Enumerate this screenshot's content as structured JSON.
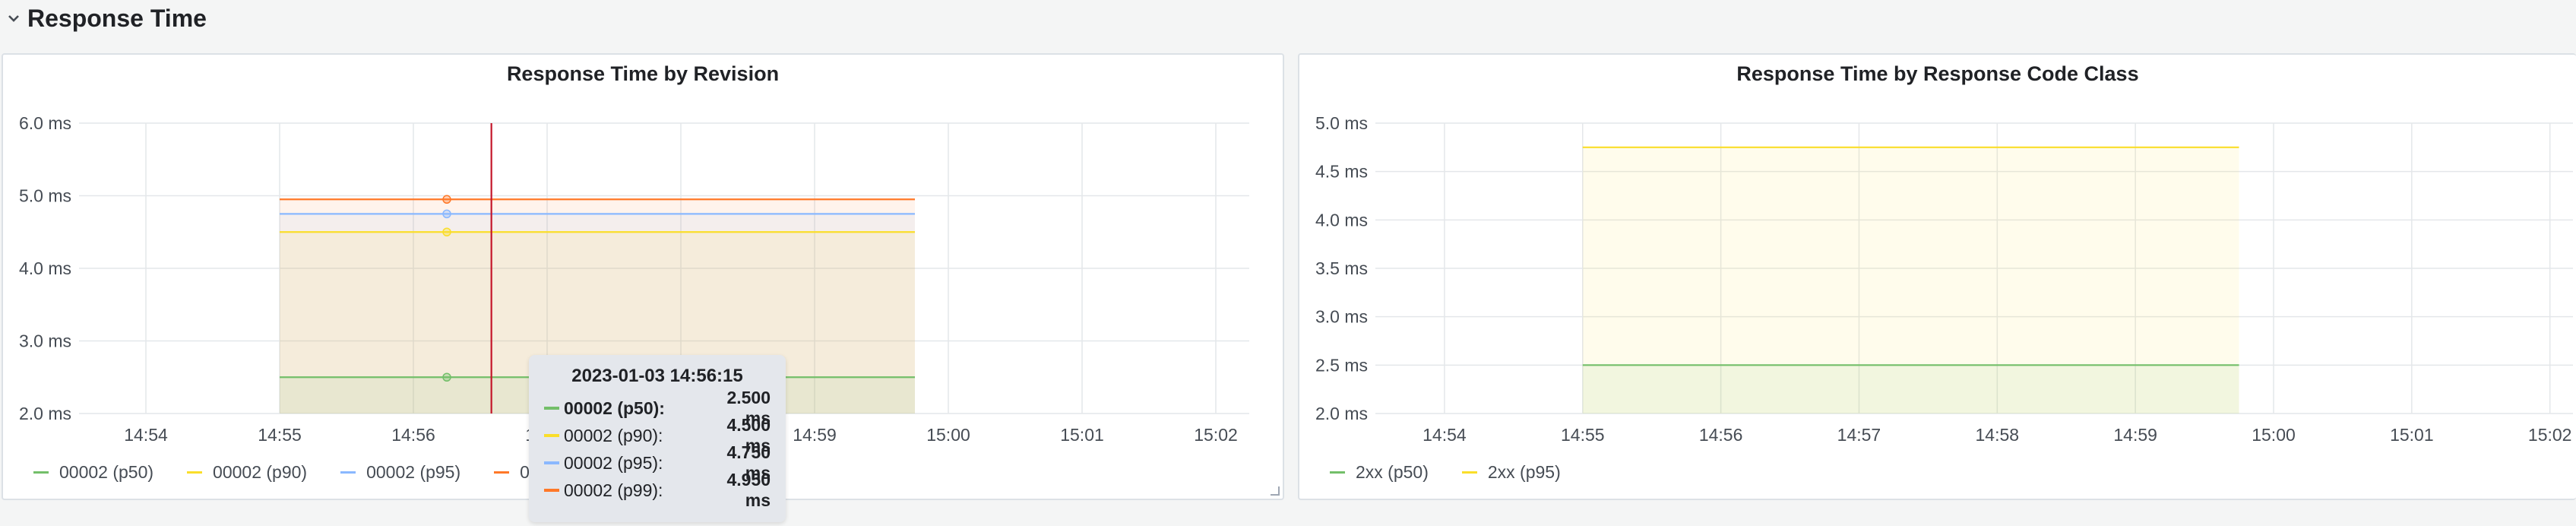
{
  "row": {
    "title": "Response Time"
  },
  "panels": [
    {
      "title": "Response Time by Revision",
      "legend": [
        {
          "label": "00002 (p50)",
          "color": "#73bf69"
        },
        {
          "label": "00002 (p90)",
          "color": "#fade2a"
        },
        {
          "label": "00002 (p95)",
          "color": "#8ab8ff"
        },
        {
          "label": "00002 (p99)",
          "color": "#ff7828"
        }
      ]
    },
    {
      "title": "Response Time by Response Code Class",
      "legend": [
        {
          "label": "2xx (p50)",
          "color": "#73bf69"
        },
        {
          "label": "2xx (p95)",
          "color": "#fade2a"
        }
      ]
    }
  ],
  "tooltip": {
    "time": "2023-01-03 14:56:15",
    "rows": [
      {
        "label": "00002 (p50):",
        "value": "2.500 ms",
        "color": "#73bf69",
        "active": true
      },
      {
        "label": "00002 (p90):",
        "value": "4.500 ms",
        "color": "#fade2a",
        "active": false
      },
      {
        "label": "00002 (p95):",
        "value": "4.750 ms",
        "color": "#8ab8ff",
        "active": false
      },
      {
        "label": "00002 (p99):",
        "value": "4.950 ms",
        "color": "#ff7828",
        "active": false
      }
    ]
  },
  "chart_data": [
    {
      "type": "area",
      "title": "Response Time by Revision",
      "unit": "ms",
      "y_ticks": [
        "2.0 ms",
        "3.0 ms",
        "4.0 ms",
        "5.0 ms",
        "6.0 ms"
      ],
      "ylim": [
        2.0,
        6.0
      ],
      "x_ticks": [
        "14:54",
        "14:55",
        "14:56",
        "14:57",
        "14:58",
        "14:59",
        "15:00",
        "15:01",
        "15:02"
      ],
      "xlim": [
        "14:53:30",
        "15:02:15"
      ],
      "grid": true,
      "legend_position": "bottom-left",
      "crosshair_time": "14:56:35",
      "hover_time": "14:56:15",
      "series": [
        {
          "name": "00002 (p50)",
          "color": "#73bf69",
          "x_start": "14:55:00",
          "x_end": "14:59:45",
          "value": 2.5
        },
        {
          "name": "00002 (p90)",
          "color": "#fade2a",
          "x_start": "14:55:00",
          "x_end": "14:59:45",
          "value": 4.5
        },
        {
          "name": "00002 (p95)",
          "color": "#8ab8ff",
          "x_start": "14:55:00",
          "x_end": "14:59:45",
          "value": 4.75
        },
        {
          "name": "00002 (p99)",
          "color": "#ff7828",
          "x_start": "14:55:00",
          "x_end": "14:59:45",
          "value": 4.95
        }
      ]
    },
    {
      "type": "area",
      "title": "Response Time by Response Code Class",
      "unit": "ms",
      "y_ticks": [
        "2.0 ms",
        "2.5 ms",
        "3.0 ms",
        "3.5 ms",
        "4.0 ms",
        "4.5 ms",
        "5.0 ms"
      ],
      "ylim": [
        2.0,
        5.0
      ],
      "x_ticks": [
        "14:54",
        "14:55",
        "14:56",
        "14:57",
        "14:58",
        "14:59",
        "15:00",
        "15:01",
        "15:02"
      ],
      "xlim": [
        "14:53:30",
        "15:02:10"
      ],
      "grid": true,
      "legend_position": "bottom-left",
      "series": [
        {
          "name": "2xx (p50)",
          "color": "#73bf69",
          "x_start": "14:55:00",
          "x_end": "14:59:45",
          "value": 2.5
        },
        {
          "name": "2xx (p95)",
          "color": "#fade2a",
          "x_start": "14:55:00",
          "x_end": "14:59:45",
          "value": 4.75
        }
      ]
    }
  ]
}
